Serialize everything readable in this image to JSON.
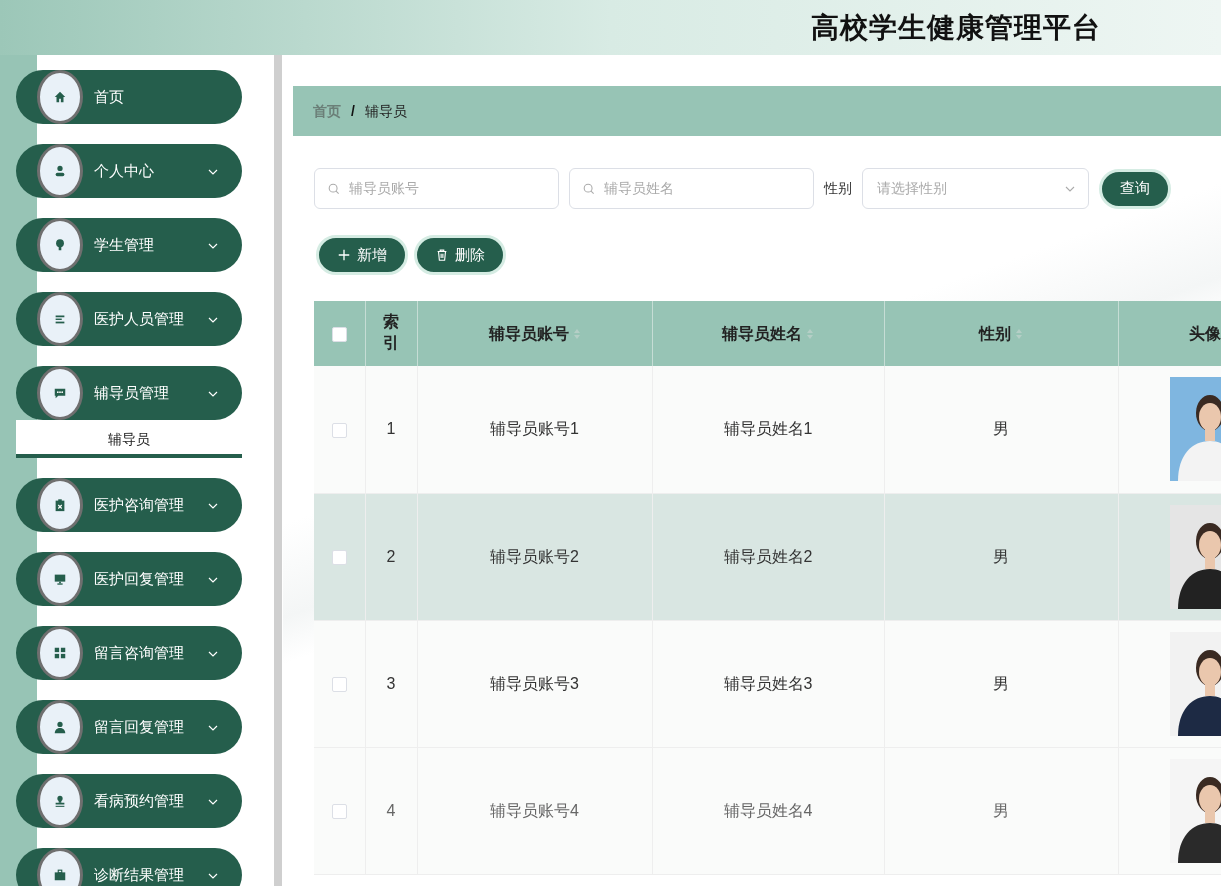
{
  "header": {
    "title": "高校学生健康管理平台"
  },
  "sidebar": {
    "items": [
      {
        "label": "首页",
        "kind": "link"
      },
      {
        "label": "个人中心",
        "kind": "menu"
      },
      {
        "label": "学生管理",
        "kind": "menu"
      },
      {
        "label": "医护人员管理",
        "kind": "menu"
      },
      {
        "label": "辅导员管理",
        "kind": "menu",
        "children": [
          {
            "label": "辅导员",
            "selected": true
          }
        ]
      },
      {
        "label": "医护咨询管理",
        "kind": "menu"
      },
      {
        "label": "医护回复管理",
        "kind": "menu"
      },
      {
        "label": "留言咨询管理",
        "kind": "menu"
      },
      {
        "label": "留言回复管理",
        "kind": "menu"
      },
      {
        "label": "看病预约管理",
        "kind": "menu"
      },
      {
        "label": "诊断结果管理",
        "kind": "menu"
      }
    ]
  },
  "breadcrumb": {
    "separator": "/",
    "items": [
      "首页",
      "辅导员"
    ]
  },
  "filters": {
    "account": {
      "placeholder": "辅导员账号"
    },
    "name": {
      "placeholder": "辅导员姓名"
    },
    "gender": {
      "label": "性别",
      "placeholder": "请选择性别"
    },
    "search_button": "查询"
  },
  "actions": [
    {
      "label": "新增",
      "kind": "add"
    },
    {
      "label": "删除",
      "kind": "delete"
    }
  ],
  "table": {
    "select_all_checked": false,
    "columns": [
      {
        "label": "索引",
        "sortable": false
      },
      {
        "label": "辅导员账号",
        "sortable": true
      },
      {
        "label": "辅导员姓名",
        "sortable": true
      },
      {
        "label": "性别",
        "sortable": true
      },
      {
        "label": "头像",
        "sortable": false
      }
    ],
    "rows": [
      {
        "index": "1",
        "account": "辅导员账号1",
        "name": "辅导员姓名1",
        "gender": "男",
        "selected": false,
        "checked": false
      },
      {
        "index": "2",
        "account": "辅导员账号2",
        "name": "辅导员姓名2",
        "gender": "男",
        "selected": true,
        "checked": false
      },
      {
        "index": "3",
        "account": "辅导员账号3",
        "name": "辅导员姓名3",
        "gender": "男",
        "selected": false,
        "checked": false
      },
      {
        "index": "4",
        "account": "辅导员账号4",
        "name": "辅导员姓名4",
        "gender": "男",
        "selected": false,
        "checked": false
      }
    ]
  }
}
